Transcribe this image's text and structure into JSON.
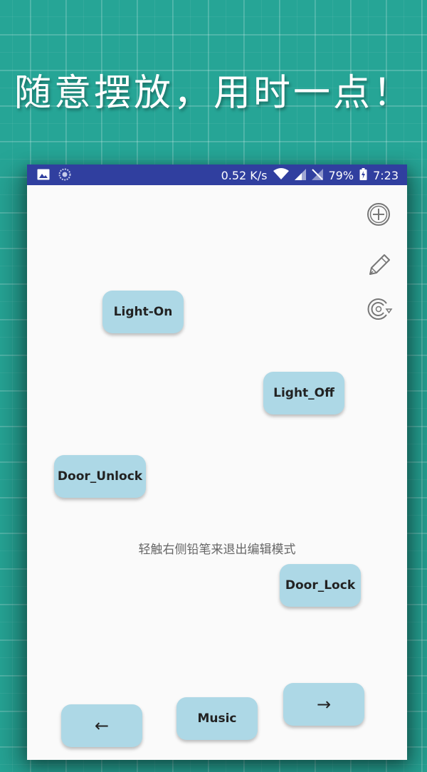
{
  "headline": "随意摆放，用时一点！",
  "status_bar": {
    "net_speed": "0.52 K/s",
    "battery": "79%",
    "time": "7:23",
    "icons": [
      "image-icon",
      "sync-icon",
      "wifi-icon",
      "signal-icon",
      "no-sim-icon",
      "battery-charging-icon"
    ]
  },
  "side_icons": [
    "add-circle-icon",
    "pencil-icon",
    "refresh-icon"
  ],
  "buttons": {
    "light_on": "Light-On",
    "light_off": "Light_Off",
    "door_unlock": "Door_Unlock",
    "door_lock": "Door_Lock",
    "left": "←",
    "music": "Music",
    "right": "→"
  },
  "hint": "轻触右侧铅笔来退出编辑模式",
  "colors": {
    "background": "#26a596",
    "status_bar": "#303f9f",
    "button": "#add8e6",
    "screen": "#fafafa"
  }
}
